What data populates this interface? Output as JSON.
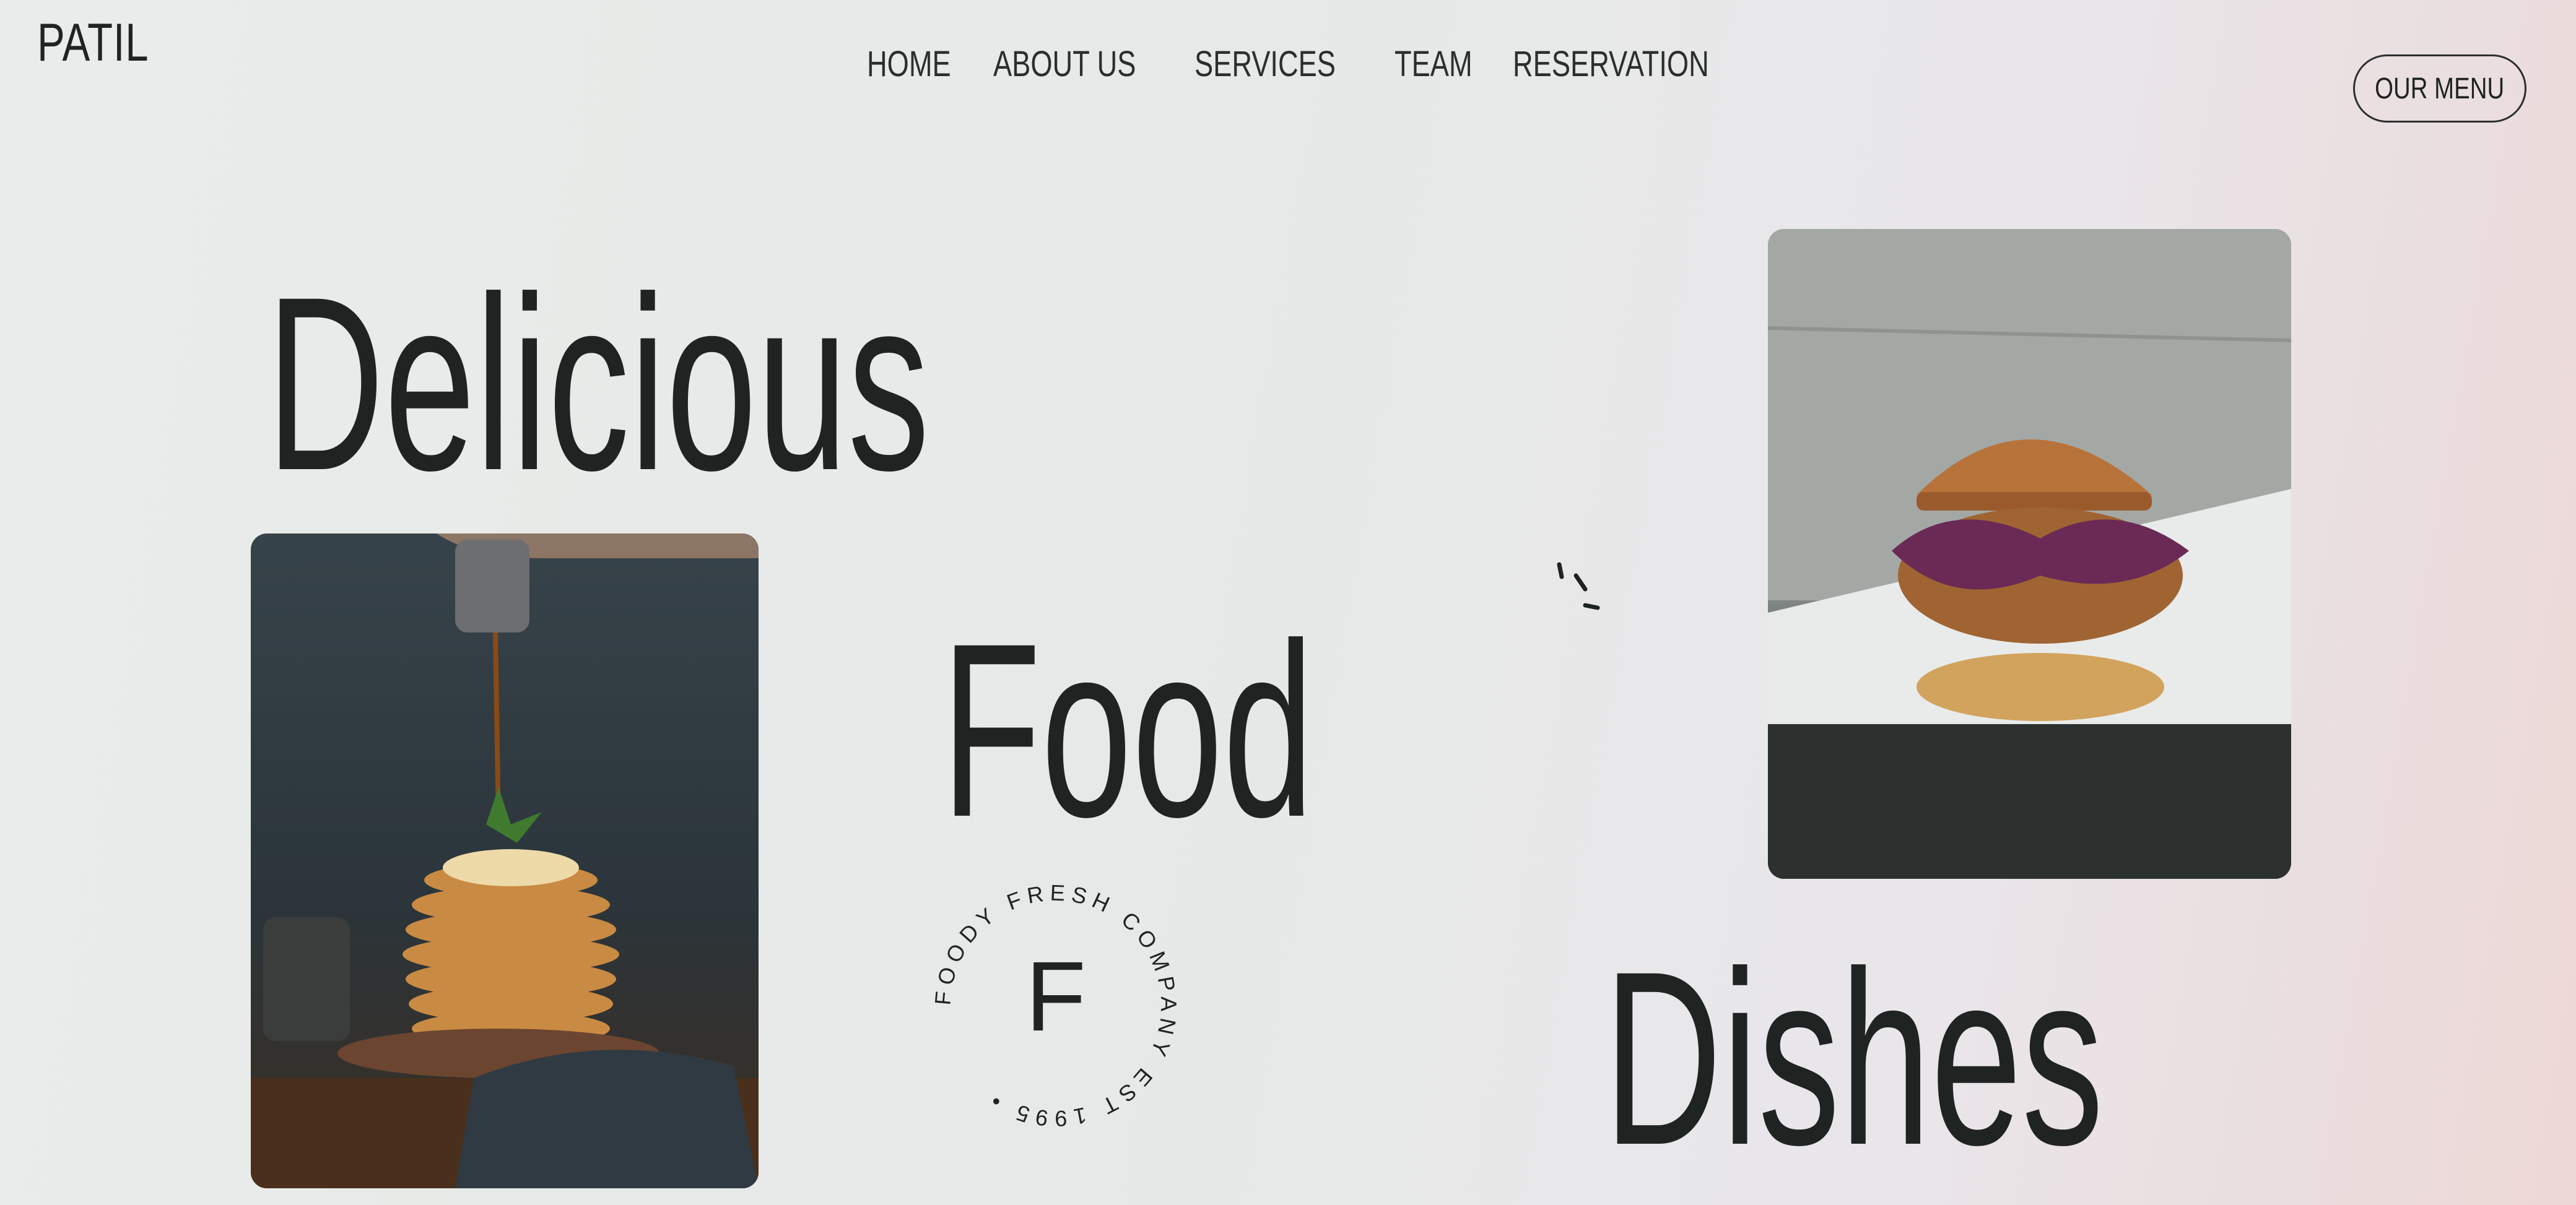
{
  "brand": {
    "logo": "PATIL"
  },
  "nav": {
    "items": [
      {
        "label": "HOME"
      },
      {
        "label": "ABOUT US"
      },
      {
        "label": "SERVICES"
      },
      {
        "label": "TEAM"
      },
      {
        "label": "RESERVATION"
      }
    ],
    "cta_label": "OUR MENU"
  },
  "hero": {
    "line1": "Delicious",
    "line2": "Food",
    "line3": "Dishes"
  },
  "stamp": {
    "letter": "F",
    "ring_text": "FOODY FRESH COMPANY EST 1995 •"
  },
  "colors": {
    "text": "#1f2322",
    "background": "#e8ebe9"
  }
}
